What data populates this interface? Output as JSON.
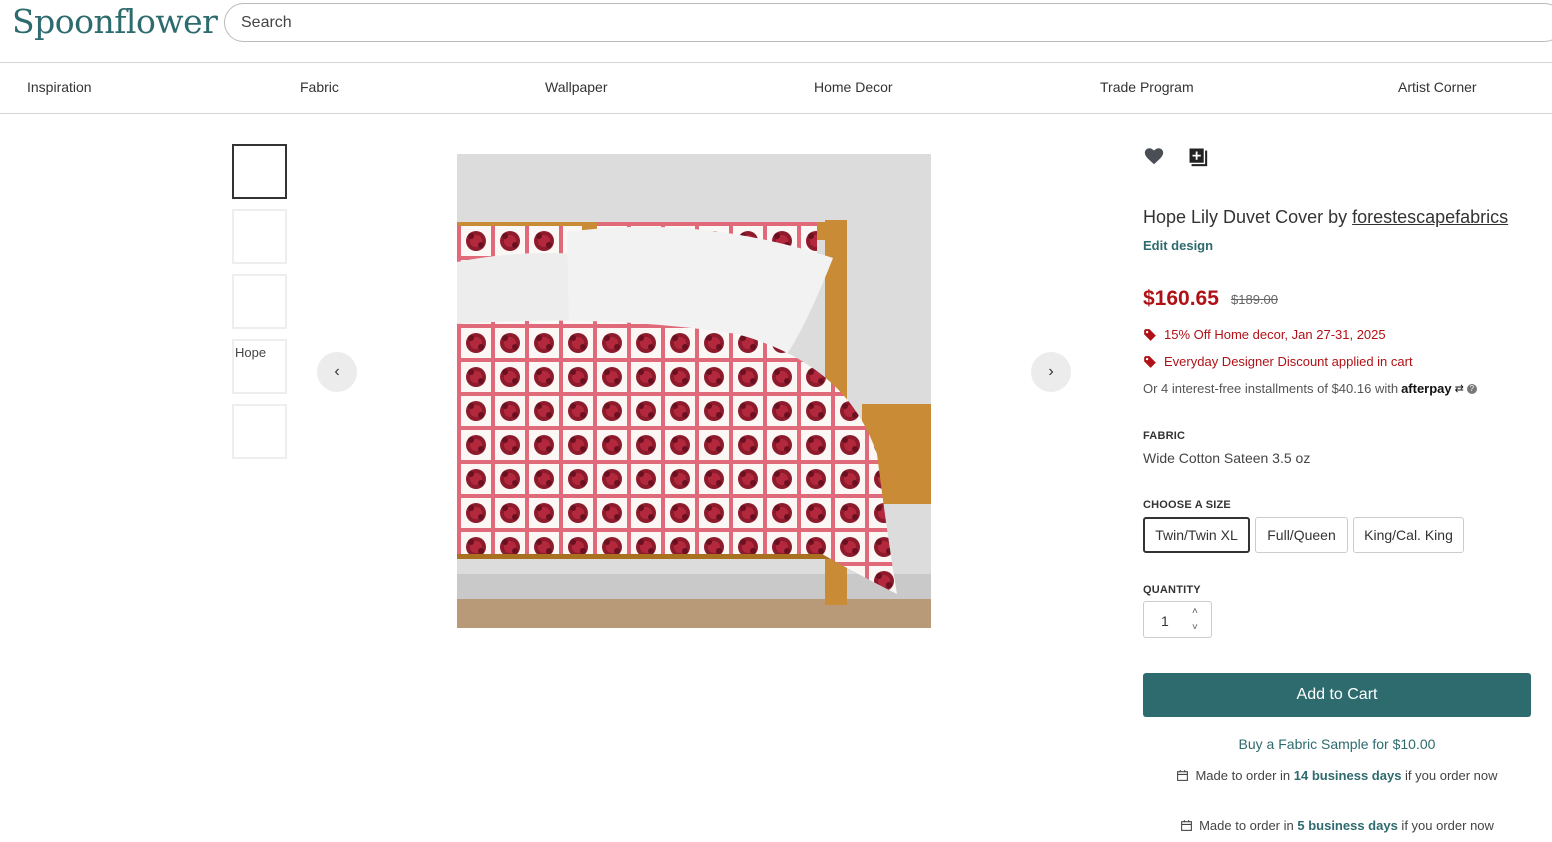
{
  "header": {
    "logo": "Spoonflower",
    "search_placeholder": "Search"
  },
  "nav": {
    "items": [
      "Inspiration",
      "Fabric",
      "Wallpaper",
      "Home Decor",
      "Trade Program",
      "Artist Corner"
    ]
  },
  "gallery": {
    "thumbnail_alt": "Hope",
    "prev_icon": "chevron-left-icon",
    "next_icon": "chevron-right-icon"
  },
  "product": {
    "title_prefix": "Hope Lily Duvet Cover by ",
    "designer": "forestescapefabrics",
    "edit_design": "Edit design",
    "price": "$160.65",
    "original_price": "$189.00",
    "promo_1": "15% Off Home decor, Jan 27-31, 2025",
    "promo_2": "Everyday Designer Discount applied in cart",
    "installments_text": "Or 4 interest-free installments of $40.16 with",
    "afterpay_label": "afterpay",
    "fabric_label": "FABRIC",
    "fabric_value": "Wide Cotton Sateen 3.5 oz",
    "size_label": "CHOOSE A SIZE",
    "sizes": [
      "Twin/Twin XL",
      "Full/Queen",
      "King/Cal. King"
    ],
    "selected_size": "Twin/Twin XL",
    "quantity_label": "QUANTITY",
    "quantity": "1",
    "add_to_cart": "Add to Cart",
    "sample_link": "Buy a Fabric Sample for $10.00",
    "mto_1_prefix": "Made to order in ",
    "mto_1_days": "14 business days",
    "mto_1_suffix": " if you order now",
    "mto_2_prefix": "Made to order in ",
    "mto_2_days": "5 business days",
    "mto_2_suffix": " if you order now"
  },
  "colors": {
    "brand": "#2e6b6e",
    "sale": "#b01116"
  }
}
